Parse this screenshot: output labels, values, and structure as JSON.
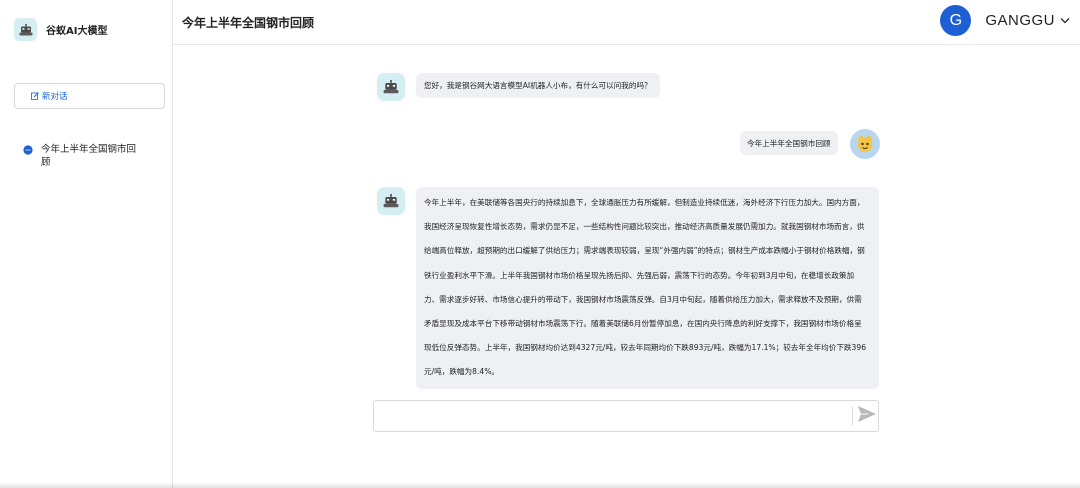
{
  "sidebar": {
    "brand_name": "谷蚁AI大模型",
    "new_chat_label": "新对话",
    "history": [
      {
        "label": "今年上半年全国钢市回顾"
      }
    ]
  },
  "header": {
    "title": "今年上半年全国钢市回顾",
    "user_initial": "G",
    "username": "GANGGU"
  },
  "messages": [
    {
      "role": "assistant",
      "text": "您好，我是钢谷网大语言模型AI机器人小布，有什么可以问我的吗？"
    },
    {
      "role": "user",
      "text": "今年上半年全国钢市回顾"
    },
    {
      "role": "assistant",
      "text": "今年上半年，在美联储等各国央行的持续加息下，全球通胀压力有所缓解，但制造业持续低迷，海外经济下行压力加大。国内方面，我国经济呈现恢复性增长态势，需求仍显不足，一些结构性问题比较突出，推动经济高质量发展仍需加力。就我国钢材市场而言，供给端高位释放，超预期的出口缓解了供给压力；需求端表现较弱，呈现“外强内弱”的特点；钢材生产成本跌幅小于钢材价格跌幅，钢铁行业盈利水平下滑。上半年我国钢材市场价格呈现先扬后抑、先强后弱，震荡下行的态势。今年初到3月中旬，在稳增长政策加力、需求逐步好转、市场信心提升的带动下，我国钢材市场震荡反弹。自3月中旬起，随着供给压力加大，需求释放不及预期，供需矛盾显现及成本平台下移带动钢材市场震荡下行。随着美联储6月份暂停加息，在国内央行降息的利好支撑下，我国钢材市场价格呈现低位反弹态势。上半年，我国钢材均价达到4327元/吨，较去年同期均价下跌893元/吨，跌幅为17.1%；较去年全年均价下跌396元/吨，跌幅为8.4%。"
    }
  ],
  "composer": {
    "value": "",
    "placeholder": ""
  },
  "colors": {
    "accent": "#1f5fd4",
    "link": "#1a5fd6",
    "bubble_bg": "#eff0f3",
    "bot_avatar_bg": "#d4eef4"
  },
  "icons": {
    "brand": "robot-icon",
    "new_chat": "edit-icon",
    "history": "chat-bubble-icon",
    "user_menu": "chevron-down-icon",
    "send": "send-icon"
  }
}
